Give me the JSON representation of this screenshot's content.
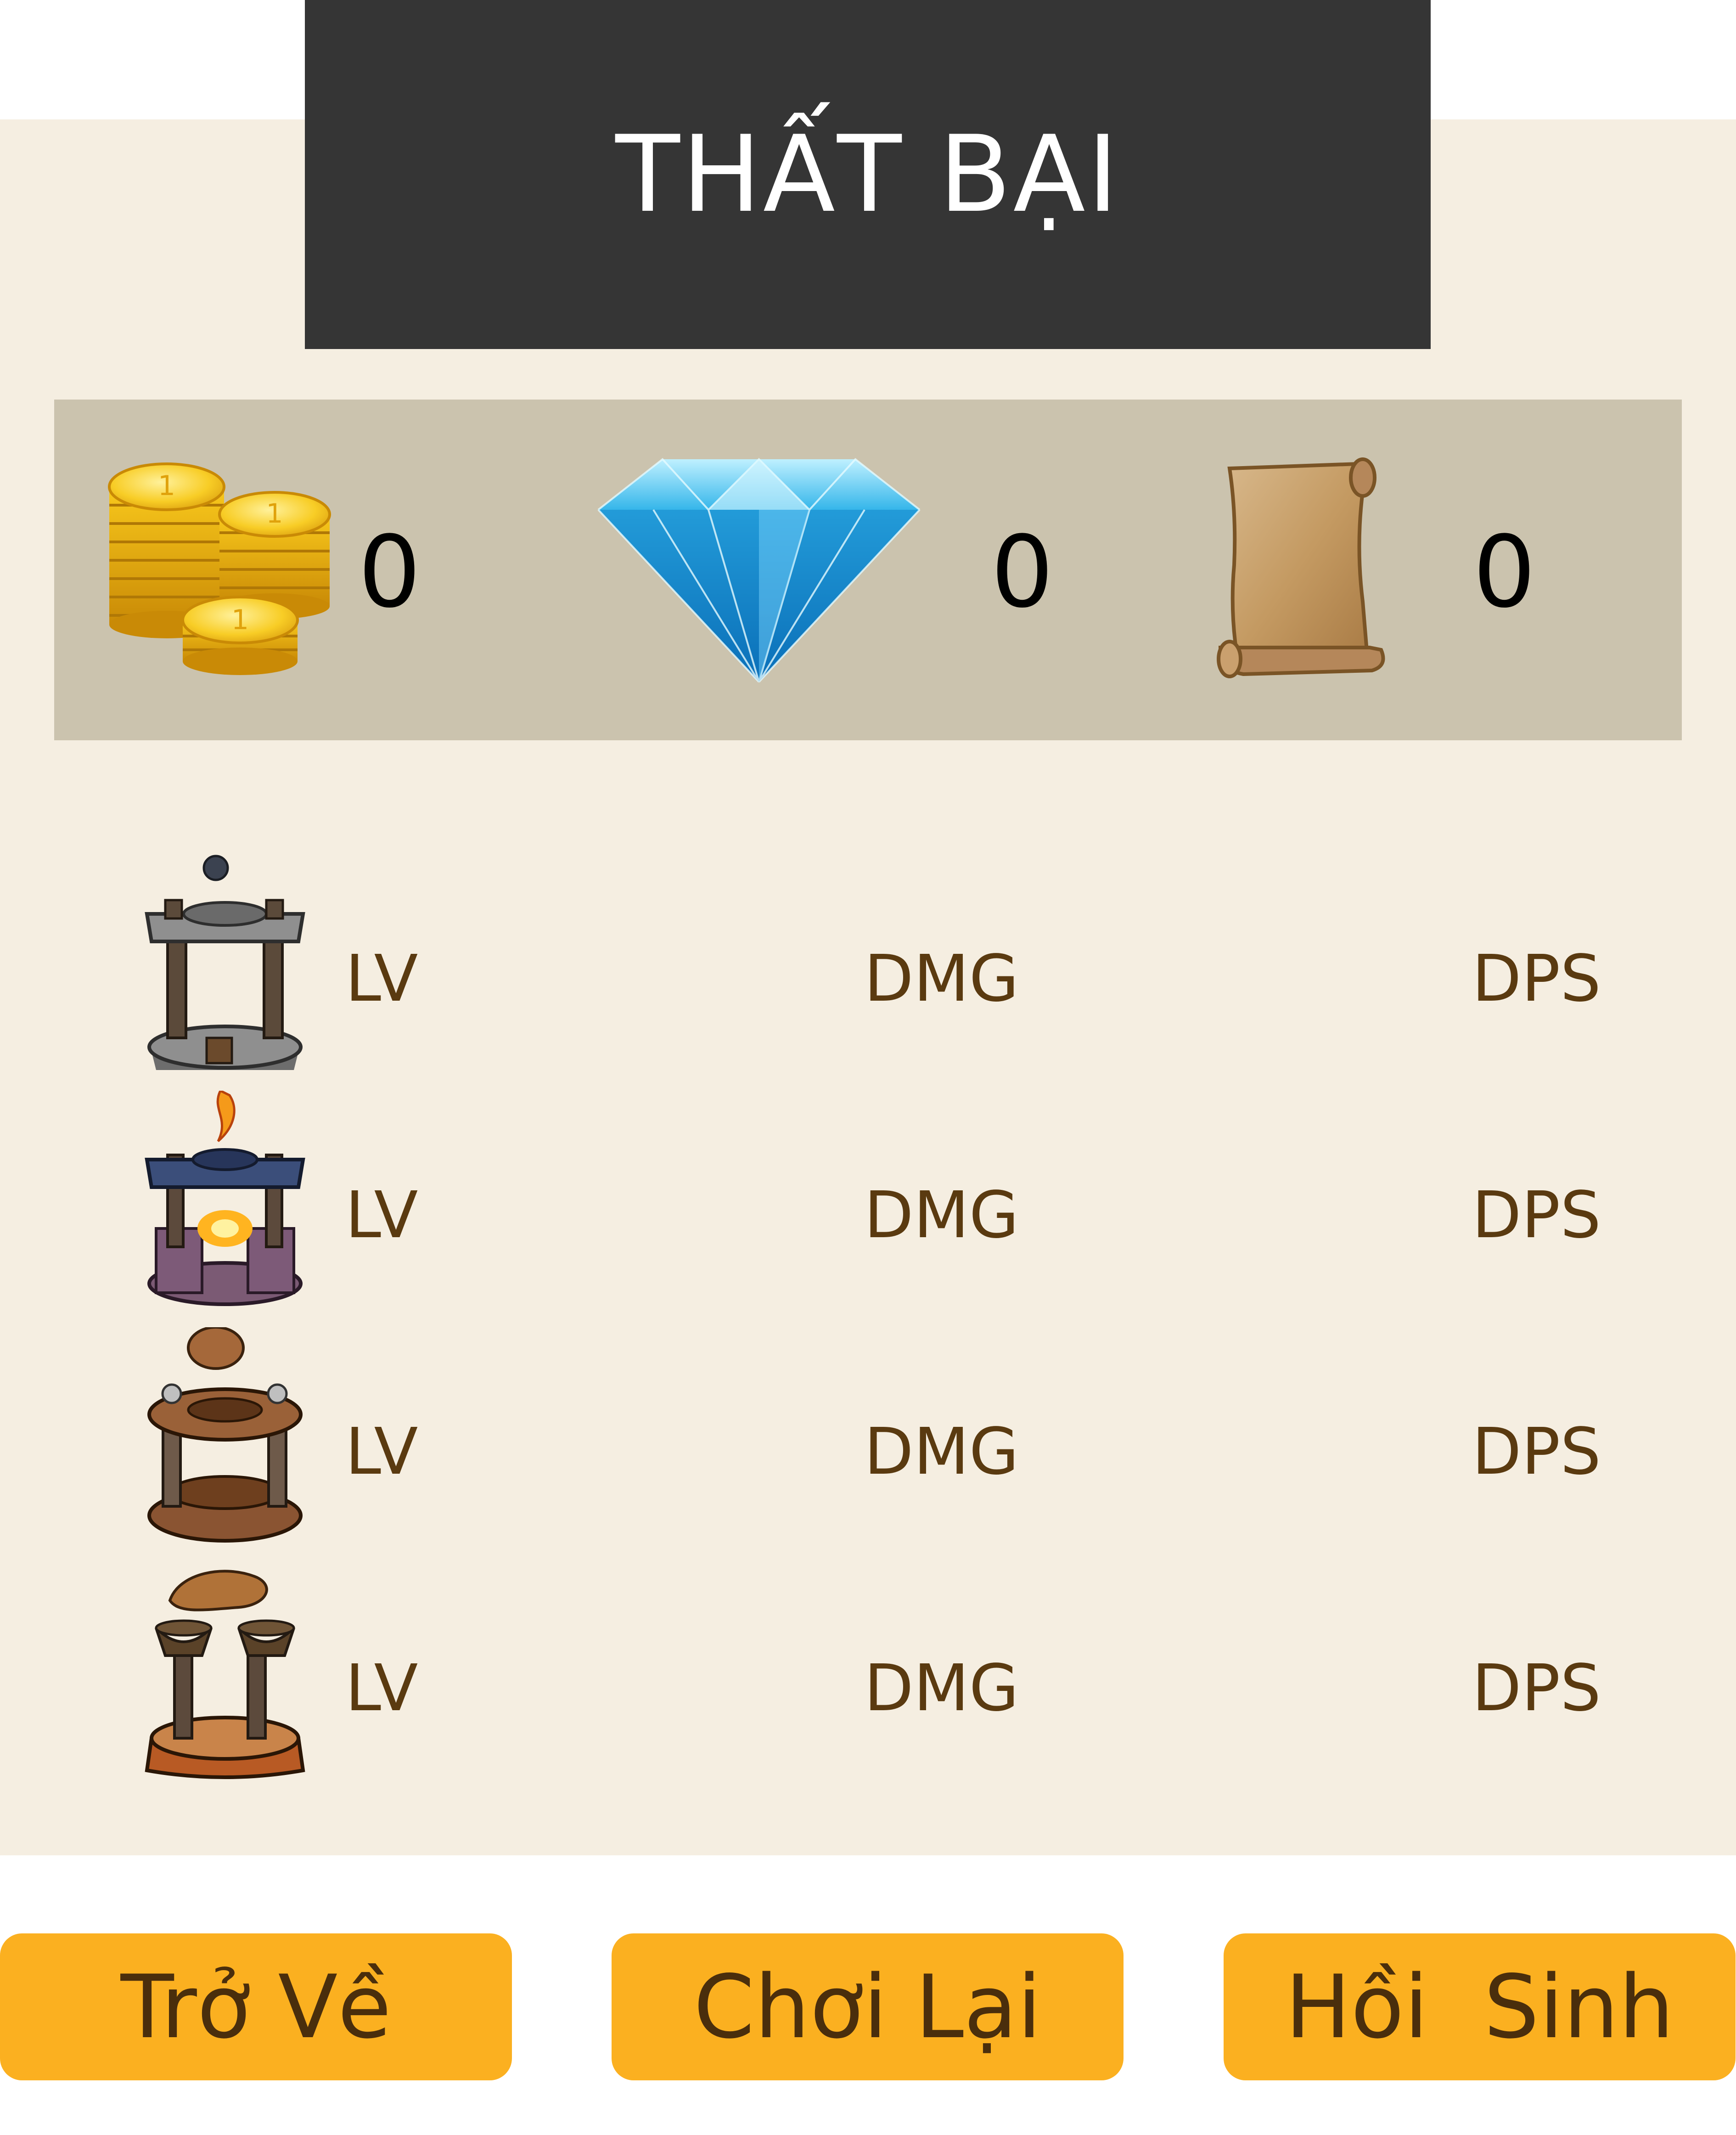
{
  "title": "THẤT BẠI",
  "rewards": {
    "gold": {
      "icon": "gold-coins-icon",
      "value": "0"
    },
    "diamond": {
      "icon": "blue-diamond-icon",
      "value": "0"
    },
    "scroll": {
      "icon": "parchment-scroll-icon",
      "value": "0"
    }
  },
  "towers": [
    {
      "icon": "stone-cannon-tower-icon",
      "lv": "LV",
      "dmg": "DMG",
      "dps": "DPS"
    },
    {
      "icon": "fire-tower-icon",
      "lv": "LV",
      "dmg": "DMG",
      "dps": "DPS"
    },
    {
      "icon": "rock-thrower-tower-icon",
      "lv": "LV",
      "dmg": "DMG",
      "dps": "DPS"
    },
    {
      "icon": "mud-tower-icon",
      "lv": "LV",
      "dmg": "DMG",
      "dps": "DPS"
    }
  ],
  "buttons": {
    "back": "Trở Về",
    "replay": "Chơi Lại",
    "revive": "Hồi  Sinh"
  },
  "colors": {
    "panel": "#f5eee1",
    "title_bg": "#353535",
    "rewards_bg": "#cbc3ae",
    "button": "#fbb020",
    "stat_text": "#5a3a10"
  }
}
